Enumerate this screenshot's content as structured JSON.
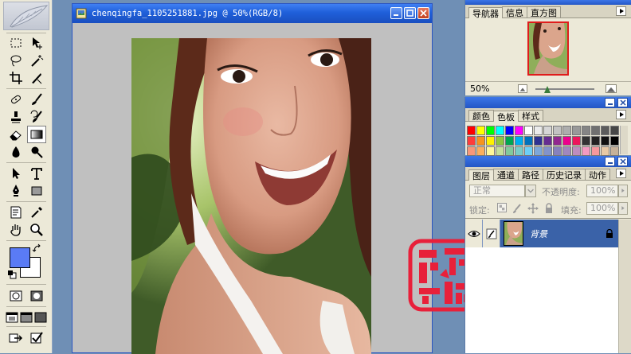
{
  "document": {
    "title": "chenqingfa_1105251881.jpg @ 50%(RGB/8)"
  },
  "toolbox": {
    "tools": [
      "marquee-tool",
      "move-tool",
      "lasso-tool",
      "magic-wand-tool",
      "crop-tool",
      "slice-tool",
      "healing-brush-tool",
      "brush-tool",
      "clone-stamp-tool",
      "history-brush-tool",
      "eraser-tool",
      "gradient-tool",
      "blur-tool",
      "dodge-tool",
      "path-selection-tool",
      "type-tool",
      "pen-tool",
      "shape-tool",
      "notes-tool",
      "eyedropper-tool",
      "hand-tool",
      "zoom-tool"
    ],
    "selected_tool": "gradient-tool",
    "foreground_color": "#5a7bf5",
    "background_color": "#ffffff"
  },
  "navigator": {
    "tabs": [
      "导航器",
      "信息",
      "直方图"
    ],
    "active_tab": "导航器",
    "zoom": "50%",
    "zoom_slider_fraction": 0.2
  },
  "color_panel": {
    "tabs": [
      "颜色",
      "色板",
      "样式"
    ],
    "active_tab": "色板",
    "swatch_rows": [
      [
        "#ff0000",
        "#ffff00",
        "#00ff00",
        "#00ffff",
        "#0000ff",
        "#ff00ff",
        "#ffffff",
        "#ebebeb",
        "#d6d6d6",
        "#c2c2c2",
        "#adadad",
        "#999999",
        "#858585",
        "#707070",
        "#5c5c5c",
        "#474747"
      ],
      [
        "#ff3b3b",
        "#f7941d",
        "#fff200",
        "#8dc63f",
        "#00a651",
        "#00aeef",
        "#0072bc",
        "#2e3192",
        "#662d91",
        "#92278f",
        "#ec008c",
        "#ed145b",
        "#333333",
        "#222222",
        "#111111",
        "#000000"
      ],
      [
        "#f7977a",
        "#fbaf5d",
        "#fff799",
        "#c4df9b",
        "#82ca9c",
        "#7accc8",
        "#6dcff6",
        "#7da7d9",
        "#8393ca",
        "#8781bd",
        "#a187be",
        "#bd8cbf",
        "#f49ac1",
        "#f6989d",
        "#e8c9a5",
        "#c7b299"
      ]
    ]
  },
  "layers_panel": {
    "tabs": [
      "图层",
      "通道",
      "路径",
      "历史记录",
      "动作"
    ],
    "active_tab": "图层",
    "blend_mode": "正常",
    "opacity_label": "不透明度:",
    "opacity_value": "100%",
    "lock_label": "锁定:",
    "fill_label": "填充:",
    "fill_value": "100%",
    "layers": [
      {
        "name": "背景",
        "visible": true,
        "locked": true,
        "selected": true
      }
    ]
  },
  "colors": {
    "titlebar": "#2356c5",
    "selected_layer": "#3a62a8",
    "workspace": "#6f8fb5"
  }
}
